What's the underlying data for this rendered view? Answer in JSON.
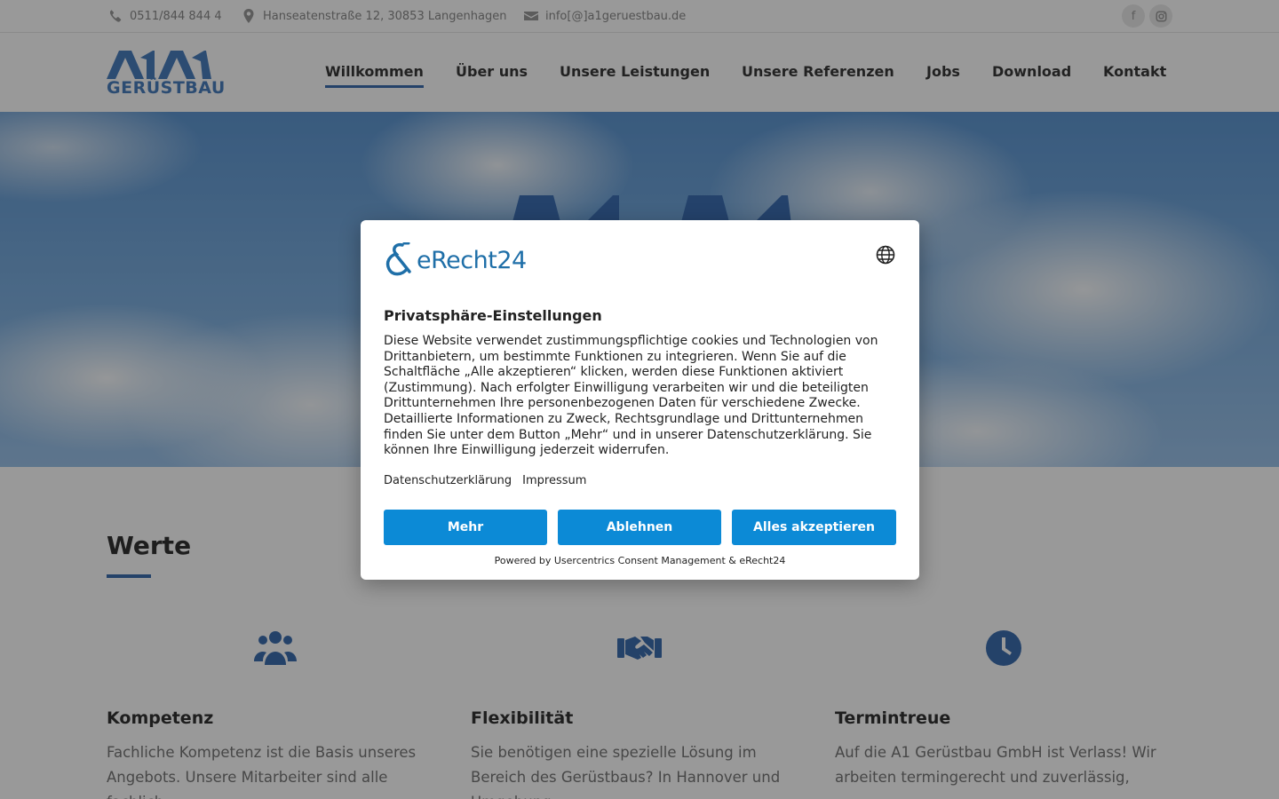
{
  "topbar": {
    "phone": "0511/844 844 4",
    "address": "Hanseatenstraße 12, 30853 Langenhagen",
    "email": "info[@]a1geruestbau.de",
    "social": {
      "facebook_glyph": "f",
      "instagram_icon": "instagram-icon",
      "phone_icon": "phone-icon",
      "location_icon": "map-pin-icon",
      "mail_icon": "mail-icon"
    }
  },
  "header": {
    "logo_text": "GERÜSTBAU",
    "nav": [
      {
        "label": "Willkommen",
        "active": true
      },
      {
        "label": "Über uns"
      },
      {
        "label": "Unsere Leistungen"
      },
      {
        "label": "Unsere Referenzen"
      },
      {
        "label": "Jobs"
      },
      {
        "label": "Download"
      },
      {
        "label": "Kontakt"
      }
    ]
  },
  "content": {
    "section_title": "Werte",
    "columns": [
      {
        "title": "Kompetenz",
        "icon": "users-icon",
        "text": "Fachliche Kompetenz ist die Basis unseres Angebots. Unsere Mitarbeiter sind alle fachlich"
      },
      {
        "title": "Flexibilität",
        "icon": "handshake-icon",
        "text": "Sie benötigen eine spezielle Lösung im Bereich des Gerüstbaus? In Hannover und Umgebung"
      },
      {
        "title": "Termintreue",
        "icon": "clock-icon",
        "text": "Auf die A1 Gerüstbau GmbH ist Verlass! Wir arbeiten termingerecht und zuverlässig,"
      }
    ]
  },
  "consent": {
    "brand": "eRecht24",
    "title": "Privatsphäre-Einstellungen",
    "body": "Diese Website verwendet zustimmungspflichtige cookies und Technologien von Drittanbietern, um bestimmte Funktionen zu integrieren. Wenn Sie auf die Schaltfläche „Alle akzeptieren“ klicken, werden diese Funktionen aktiviert (Zustimmung). Nach erfolgter Einwilligung verarbeiten wir und die beteiligten Drittunternehmen Ihre personenbezogenen Daten für verschiedene Zwecke. Detaillierte Informationen zu Zweck, Rechtsgrundlage und Drittunternehmen finden Sie unter dem Button „Mehr“ und in unserer Datenschutzerklärung. Sie können Ihre Einwilligung jederzeit widerrufen.",
    "links": {
      "privacy": "Datenschutzerklärung",
      "imprint": "Impressum"
    },
    "buttons": {
      "more": "Mehr",
      "decline": "Ablehnen",
      "accept_all": "Alles akzeptieren"
    },
    "powered_by": "Powered by Usercentrics Consent Management & eRecht24",
    "button_color": "#0c8ad6",
    "language_icon": "globe-icon"
  },
  "colors": {
    "accent": "#3d6fb0",
    "overlay": "rgba(0,0,0,0.4)"
  }
}
